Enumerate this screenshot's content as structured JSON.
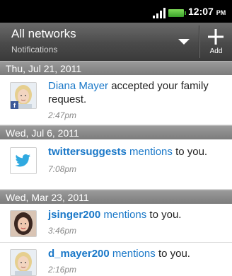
{
  "status_bar": {
    "time": "12:07",
    "ampm": "PM"
  },
  "header": {
    "filter_title": "All networks",
    "filter_subtitle": "Notifications",
    "add_label": "Add"
  },
  "sections": [
    {
      "date": "Thu, Jul 21, 2011",
      "items": [
        {
          "name": "Diana Mayer",
          "text": " accepted your family request.",
          "time": "2:47pm",
          "avatar": "woman-blonde-avatar",
          "network_badge": "f"
        }
      ]
    },
    {
      "date": "Wed, Jul 6, 2011",
      "items": [
        {
          "name": "twittersuggests",
          "mentions": "mentions",
          "text": " to you.",
          "time": "7:08pm",
          "avatar": "twitter-bird-icon"
        }
      ]
    },
    {
      "date": "Wed, Mar 23, 2011",
      "items": [
        {
          "name": "jsinger200",
          "mentions": "mentions",
          "text": " to you.",
          "time": "3:46pm",
          "avatar": "woman-dark-hair-avatar"
        },
        {
          "name": "d_mayer200",
          "mentions": "mentions",
          "text": " to you.",
          "time": "2:16pm",
          "avatar": "woman-blonde-avatar"
        }
      ]
    }
  ],
  "colors": {
    "link": "#1a78c8",
    "section_header": "#8a8a8a",
    "header_bar": "#4a4a4a",
    "facebook": "#3b5998",
    "twitter": "#2fa9e0"
  }
}
